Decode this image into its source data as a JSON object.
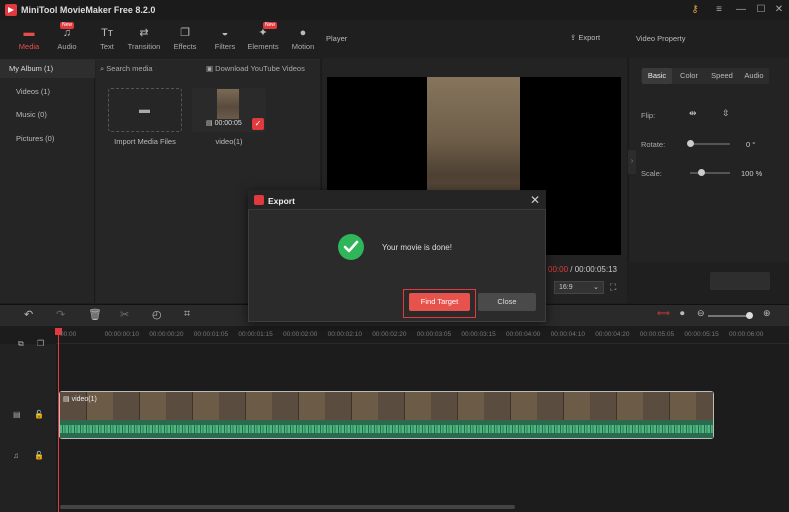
{
  "app": {
    "title": "MiniTool MovieMaker Free 8.2.0"
  },
  "tabs": [
    {
      "label": "Media",
      "icon": "folder-icon",
      "new": false
    },
    {
      "label": "Audio",
      "icon": "music-note-icon",
      "new": true,
      "badge": "New"
    },
    {
      "label": "Text",
      "icon": "text-icon",
      "new": false
    },
    {
      "label": "Transition",
      "icon": "transition-icon",
      "new": false
    },
    {
      "label": "Effects",
      "icon": "effects-icon",
      "new": false
    },
    {
      "label": "Filters",
      "icon": "filters-icon",
      "new": false
    },
    {
      "label": "Elements",
      "icon": "elements-icon",
      "new": true,
      "badge": "New"
    },
    {
      "label": "Motion",
      "icon": "motion-icon",
      "new": false
    }
  ],
  "sidebar": {
    "items": [
      {
        "label": "My Album (1)"
      },
      {
        "label": "Videos (1)"
      },
      {
        "label": "Music (0)"
      },
      {
        "label": "Pictures (0)"
      }
    ]
  },
  "media": {
    "search_placeholder": "Search media",
    "download_label": "Download YouTube Videos",
    "import_label": "Import Media Files",
    "clip_name": "video(1)",
    "clip_duration": "00:00:05"
  },
  "player": {
    "label": "Player",
    "export_label": "Export",
    "time_current": "00:00",
    "time_total": "/ 00:00:05:13",
    "aspect": "16:9"
  },
  "props": {
    "label": "Video Property",
    "tabs": [
      "Basic",
      "Color",
      "Speed",
      "Audio"
    ],
    "flip_label": "Flip:",
    "rotate_label": "Rotate:",
    "rotate_value": "0 °",
    "scale_label": "Scale:",
    "scale_value": "100 %"
  },
  "timeline": {
    "ticks": [
      "00:00",
      "00:00:00:10",
      "00:00:00:20",
      "00:00:01:05",
      "00:00:01:15",
      "00:00:02:00",
      "00:00:02:10",
      "00:00:02:20",
      "00:00:03:05",
      "00:00:03:15",
      "00:00:04:00",
      "00:00:04:10",
      "00:00:04:20",
      "00:00:05:05",
      "00:00:05:15",
      "00:00:06:00"
    ],
    "clip_label": "video(1)"
  },
  "modal": {
    "title": "Export",
    "message": "Your movie is done!",
    "find_target": "Find Target",
    "close": "Close"
  },
  "colors": {
    "accent": "#e0393e",
    "success": "#2fb55a",
    "button_primary": "#e8524d"
  }
}
